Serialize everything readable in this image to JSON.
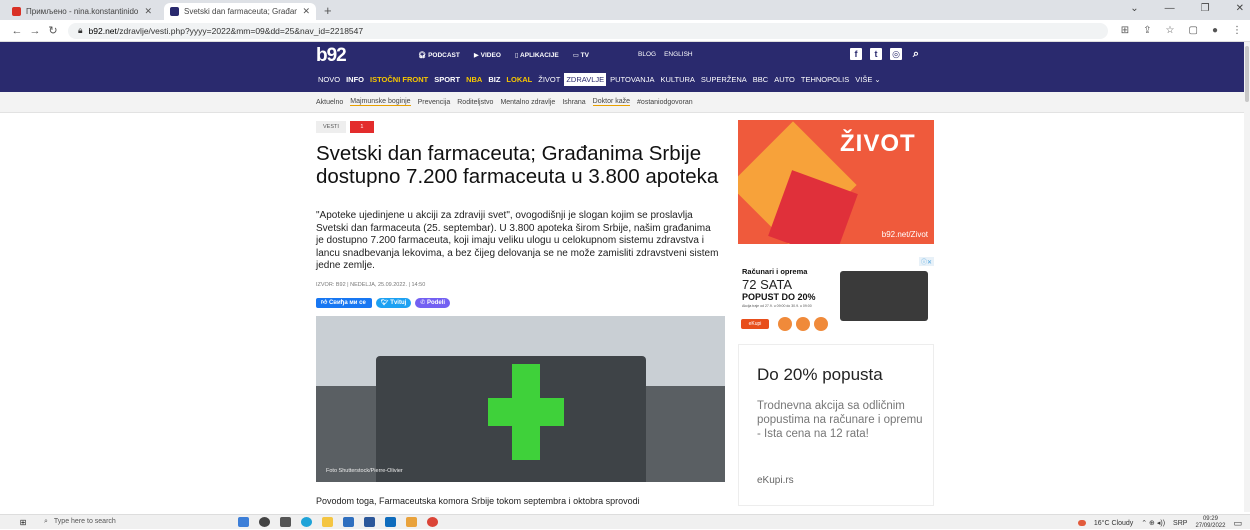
{
  "browser": {
    "tabs": [
      {
        "title": "Примљено - nina.konstantinido",
        "close": "✕",
        "icon_color": "#d93025"
      },
      {
        "title": "Svetski dan farmaceuta; Građan",
        "close": "✕",
        "icon_color": "#2a2a6e"
      }
    ],
    "new_tab": "+",
    "window_controls": [
      "⌄",
      "—",
      "❐",
      "✕"
    ],
    "nav": {
      "back": "←",
      "forward": "→",
      "reload": "↻"
    },
    "url_domain": "b92.net",
    "url_path": "/zdravlje/vesti.php?yyyy=2022&mm=09&dd=25&nav_id=2218547",
    "right_icons": [
      "⊞",
      "⇪",
      "☆",
      "▢",
      "●",
      "⋮"
    ]
  },
  "site": {
    "logo": "b92",
    "header_links": [
      "PODCAST",
      "VIDEO",
      "APLIKACIJE",
      "TV"
    ],
    "header_links2": [
      "BLOG",
      "ENGLISH"
    ],
    "social": [
      "f",
      "t",
      "◎",
      "⌕"
    ],
    "main_nav": [
      {
        "label": "NOVO",
        "style": ""
      },
      {
        "label": "INFO",
        "style": "b"
      },
      {
        "label": "ISTOČNI FRONT",
        "style": "y"
      },
      {
        "label": "SPORT",
        "style": "b"
      },
      {
        "label": "NBA",
        "style": "y"
      },
      {
        "label": "BIZ",
        "style": "b"
      },
      {
        "label": "LOKAL",
        "style": "y"
      },
      {
        "label": "ŽIVOT",
        "style": ""
      },
      {
        "label": "ZDRAVLJE",
        "style": "act"
      },
      {
        "label": "PUTOVANJA",
        "style": ""
      },
      {
        "label": "KULTURA",
        "style": ""
      },
      {
        "label": "SUPERŽENA",
        "style": ""
      },
      {
        "label": "BBC",
        "style": ""
      },
      {
        "label": "AUTO",
        "style": ""
      },
      {
        "label": "TEHNOPOLIS",
        "style": ""
      },
      {
        "label": "VIŠE ⌄",
        "style": ""
      }
    ],
    "sub_nav": [
      "Aktuelno",
      "Majmunske boginje",
      "Prevencija",
      "Roditeljstvo",
      "Mentalno zdravlje",
      "Ishrana",
      "Doktor kaže",
      "#ostaniodgovoran"
    ]
  },
  "article": {
    "tag": "VESTI",
    "tag2": "1",
    "title": "Svetski dan farmaceuta; Građanima Srbije dostupno 7.200 farmaceuta u 3.800 apoteka",
    "lead": "\"Apoteke ujedinjene u akciji za zdraviji svet\", ovogodišnji je slogan kojim se proslavlja Svetski dan farmaceuta (25. septembar). U 3.800 apoteka širom Srbije, našim građanima je dostupno 7.200 farmaceuta, koji imaju veliku ulogu u celokupnom sistemu zdravstva i lancu snadbevanja lekovima, a bez čijeg delovanja se ne može zamisliti zdravstveni sistem jedne zemlje.",
    "meta": "IZVOR: B92 | NEDELJA, 25.09.2022. | 14:50",
    "share": {
      "facebook": "Свиђа ми се",
      "twitter": "Tvituj",
      "viber": "Podeli"
    },
    "photo_caption": "Foto Shutterstock/Pierre-Olivier",
    "para2": "Povodom toga, Farmaceutska komora Srbije tokom septembra i oktobra sprovodi"
  },
  "sidebar": {
    "zivot_title": "ŽIVOT",
    "zivot_link": "b92.net/Zivot",
    "ad1": {
      "line1": "Računari i oprema",
      "line2": "72 SATA",
      "line3": "POPUST DO 20%",
      "fine": "Akcija traje od 27.9. u 09:00 do 30.9. u 09:00",
      "brand": "eKupi",
      "ad_choices": "ⓘ✕"
    },
    "ad2": {
      "title": "Do 20% popusta",
      "body": "Trodnevna akcija sa odličnim popustima na računare i opremu - Ista cena na 12 rata!",
      "source": "eKupi.rs"
    }
  },
  "taskbar": {
    "start": "⊞",
    "search_icon": "⌕",
    "search_placeholder": "Type here to search",
    "weather": "16°C  Cloudy",
    "lang": "SRP",
    "time": "09:29",
    "date": "27/09/2022",
    "tray_icons": "⌃ ⊕ ◂))"
  }
}
